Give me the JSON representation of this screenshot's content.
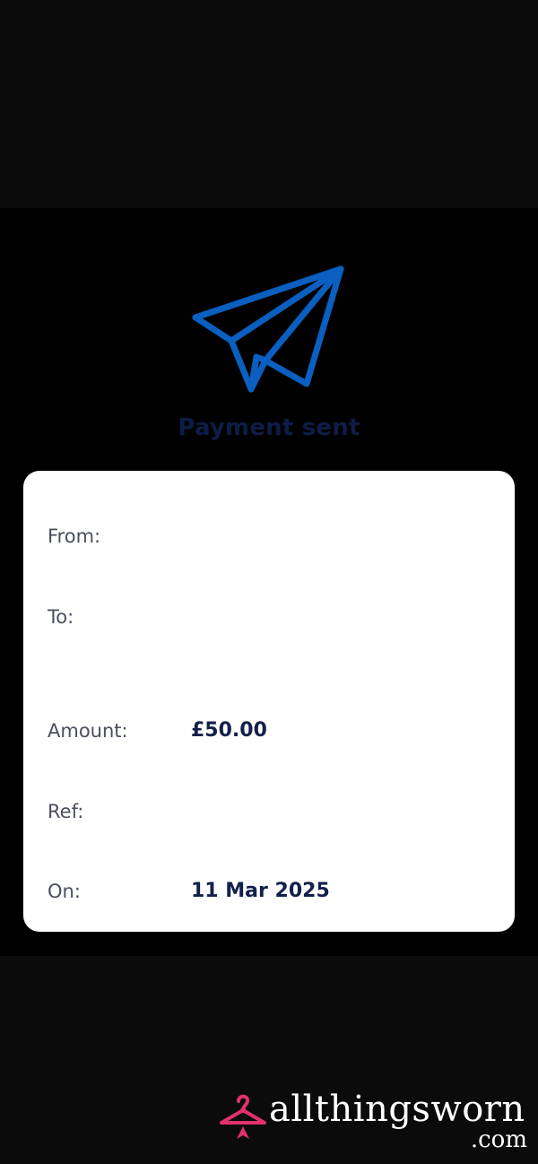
{
  "status": {
    "title": "Payment sent"
  },
  "details": {
    "from_label": "From:",
    "to_label": "To:",
    "amount_label": "Amount:",
    "amount_value": "£50.00",
    "ref_label": "Ref:",
    "on_label": "On:",
    "on_value": "11 Mar 2025"
  },
  "icons": {
    "status_icon": "paper-plane-icon",
    "watermark_icon": "hanger-logo-icon"
  },
  "watermark": {
    "text": "allthingsworn",
    "suffix": ".com"
  },
  "colors": {
    "icon_blue": "#0a5fc0",
    "title_navy": "#0e1d46",
    "value_navy": "#12204a",
    "brand_pink": "#e0316e"
  }
}
